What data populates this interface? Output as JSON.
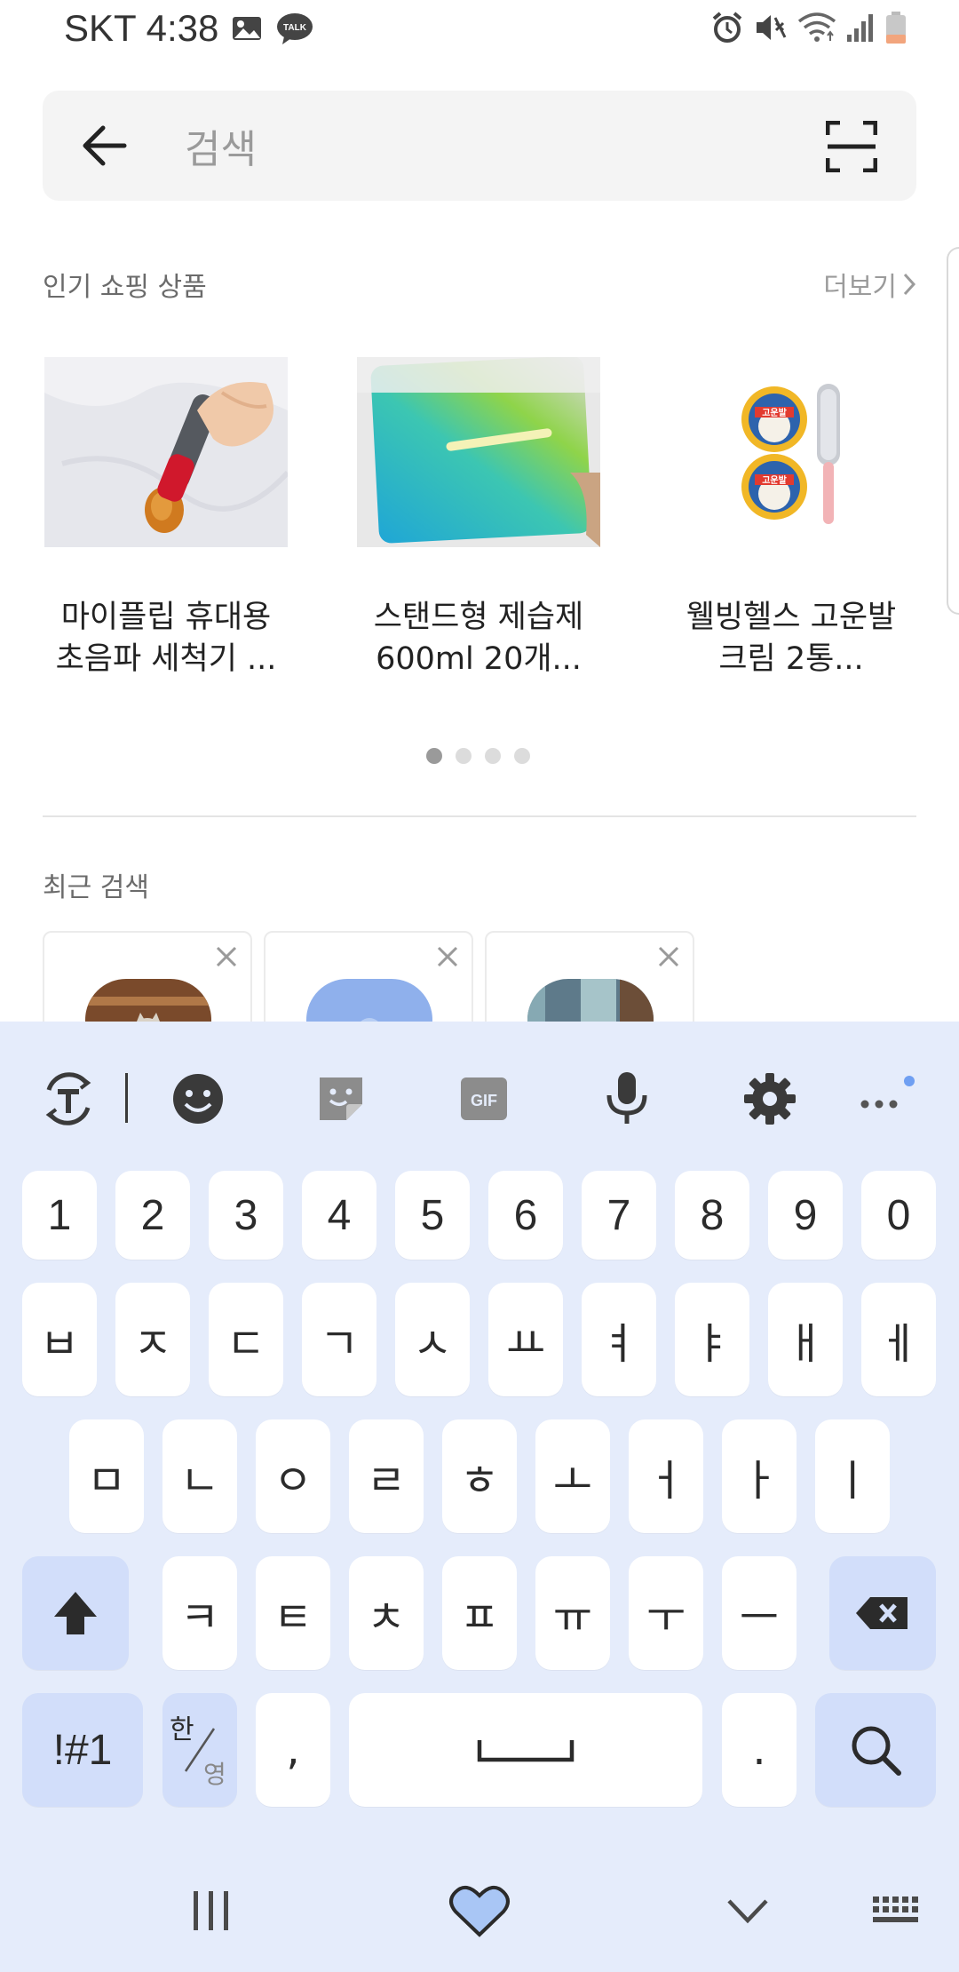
{
  "status_bar": {
    "carrier_time": "SKT 4:38",
    "icons": [
      "gallery-icon",
      "talk-icon",
      "alarm-icon",
      "mute-icon",
      "wifi-icon",
      "signal-icon",
      "battery-icon"
    ],
    "talk_badge": "TALK"
  },
  "search": {
    "placeholder": "검색"
  },
  "popular": {
    "title": "인기 쇼핑 상품",
    "more_label": "더보기",
    "products": [
      {
        "line1": "마이플립 휴대용",
        "line2": "초음파 세척기 ..."
      },
      {
        "line1": "스탠드형 제습제",
        "line2": "600ml 20개..."
      },
      {
        "line1": "웰빙헬스 고운발",
        "line2": "크림 2통..."
      }
    ],
    "product3_label": "고운발",
    "page_count": 4,
    "active_page": 1
  },
  "recent": {
    "title": "최근 검색"
  },
  "keyboard": {
    "toolbar": [
      "translate-icon",
      "emoji-icon",
      "sticker-icon",
      "gif-icon",
      "mic-icon",
      "settings-icon",
      "more-icon"
    ],
    "gif_label": "GIF",
    "row_numbers": [
      "1",
      "2",
      "3",
      "4",
      "5",
      "6",
      "7",
      "8",
      "9",
      "0"
    ],
    "row1": [
      "ㅂ",
      "ㅈ",
      "ㄷ",
      "ㄱ",
      "ㅅ",
      "ㅛ",
      "ㅕ",
      "ㅑ",
      "ㅐ",
      "ㅔ"
    ],
    "row2": [
      "ㅁ",
      "ㄴ",
      "ㅇ",
      "ㄹ",
      "ㅎ",
      "ㅗ",
      "ㅓ",
      "ㅏ",
      "ㅣ"
    ],
    "row3": [
      "ㅋ",
      "ㅌ",
      "ㅊ",
      "ㅍ",
      "ㅠ",
      "ㅜ",
      "ㅡ"
    ],
    "symbols_label": "!#1",
    "lang_top": "한",
    "lang_bottom": "영",
    "comma": ",",
    "period": ".",
    "accent_color": "#d2defa",
    "background_color": "#e5ecfb"
  },
  "nav": {
    "icons": [
      "recent-apps-icon",
      "heart-icon",
      "hide-keyboard-icon",
      "keyboard-switch-icon"
    ]
  }
}
